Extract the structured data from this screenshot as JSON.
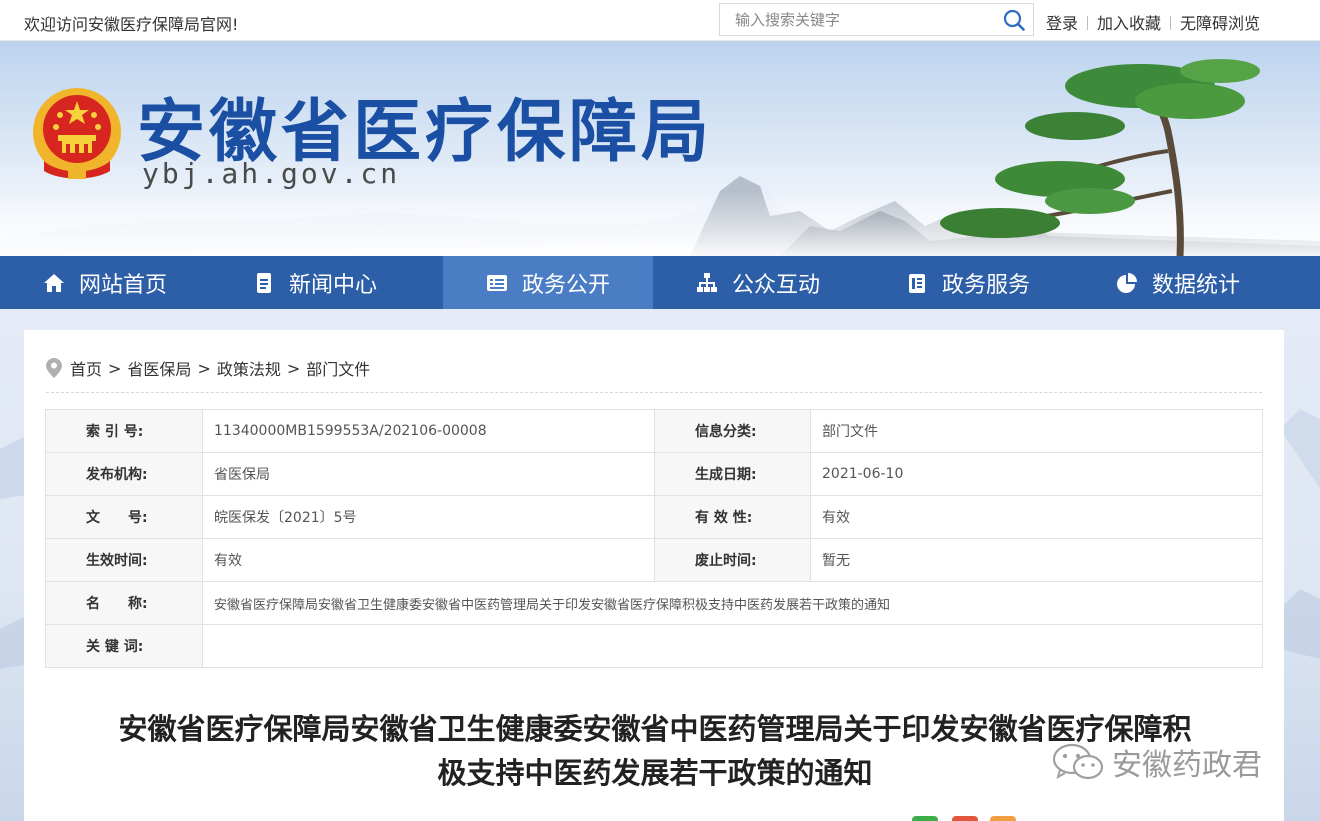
{
  "topbar": {
    "welcome": "欢迎访问安徽医疗保障局官网!",
    "search_placeholder": "输入搜索关键字",
    "links": [
      "登录",
      "加入收藏",
      "无障碍浏览"
    ]
  },
  "banner": {
    "title": "安徽省医疗保障局",
    "domain": "ybj.ah.gov.cn"
  },
  "nav": {
    "active_index": 2,
    "items": [
      {
        "label": "网站首页",
        "icon": "home-icon"
      },
      {
        "label": "新闻中心",
        "icon": "document-icon"
      },
      {
        "label": "政务公开",
        "icon": "list-icon"
      },
      {
        "label": "公众互动",
        "icon": "sitemap-icon"
      },
      {
        "label": "政务服务",
        "icon": "clipboard-icon"
      },
      {
        "label": "数据统计",
        "icon": "pie-chart-icon"
      }
    ]
  },
  "breadcrumb": {
    "items": [
      "首页",
      "省医保局",
      "政策法规",
      "部门文件"
    ],
    "separator": ">"
  },
  "meta": {
    "index_label": "索 引 号:",
    "index_value": "11340000MB1599553A/202106-00008",
    "category_label": "信息分类:",
    "category_value": "部门文件",
    "publisher_label": "发布机构:",
    "publisher_value": "省医保局",
    "date_label": "生成日期:",
    "date_value": "2021-06-10",
    "docno_label": "文　　号:",
    "docno_value": "皖医保发〔2021〕5号",
    "validity_label": "有 效 性:",
    "validity_value": "有效",
    "effective_label": "生效时间:",
    "effective_value": "有效",
    "repeal_label": "废止时间:",
    "repeal_value": "暂无",
    "name_label": "名　　称:",
    "name_value": "安徽省医疗保障局安徽省卫生健康委安徽省中医药管理局关于印发安徽省医疗保障积极支持中医药发展若干政策的通知",
    "keywords_label": "关 键 词:",
    "keywords_value": ""
  },
  "document": {
    "title_line1": "安徽省医疗保障局安徽省卫生健康委安徽省中医药管理局关于印发安徽省医疗保障积",
    "title_line2": "极支持中医药发展若干政策的通知"
  },
  "watermark": "安徽药政君",
  "colors": {
    "nav_bg": "#2d5ea8",
    "nav_active": "#4a7dc4",
    "title_blue": "#1b4fa3"
  }
}
